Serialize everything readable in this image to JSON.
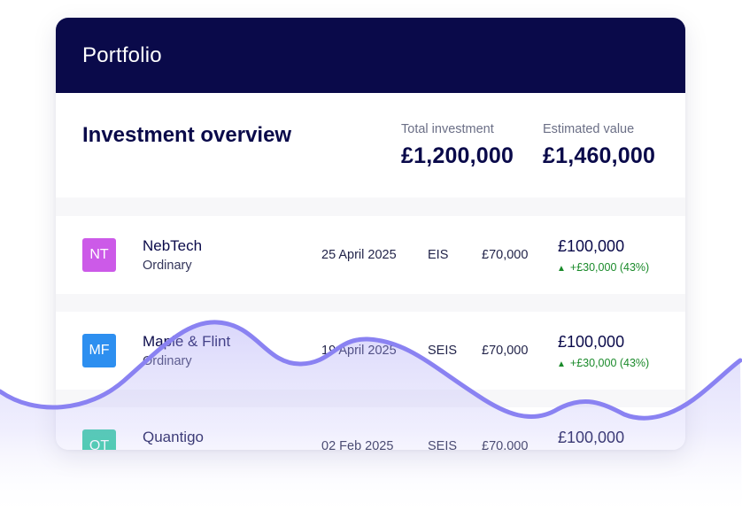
{
  "header": {
    "title": "Portfolio"
  },
  "overview": {
    "title": "Investment overview",
    "total_label": "Total investment",
    "total_value": "£1,200,000",
    "estimated_label": "Estimated value",
    "estimated_value": "£1,460,000"
  },
  "investments": [
    {
      "initials": "NT",
      "color": "#cc5ae8",
      "name": "NebTech",
      "share_class": "Ordinary",
      "date": "25 April 2025",
      "scheme": "EIS",
      "invested": "£70,000",
      "value": "£100,000",
      "change": "+£30,000 (43%)"
    },
    {
      "initials": "MF",
      "color": "#2d8ff0",
      "name": "Maple & Flint",
      "share_class": "Ordinary",
      "date": "19 April 2025",
      "scheme": "SEIS",
      "invested": "£70,000",
      "value": "£100,000",
      "change": "+£30,000 (43%)"
    },
    {
      "initials": "QT",
      "color": "#2ec9a0",
      "name": "Quantigo",
      "share_class": "",
      "date": "02 Feb 2025",
      "scheme": "SEIS",
      "invested": "£70,000",
      "value": "£100,000",
      "change": ""
    }
  ],
  "colors": {
    "header_bg": "#0a0a4a",
    "wave_line": "#8a82f2",
    "positive": "#1a8a2a"
  },
  "icons": {
    "change_up": "▲"
  }
}
